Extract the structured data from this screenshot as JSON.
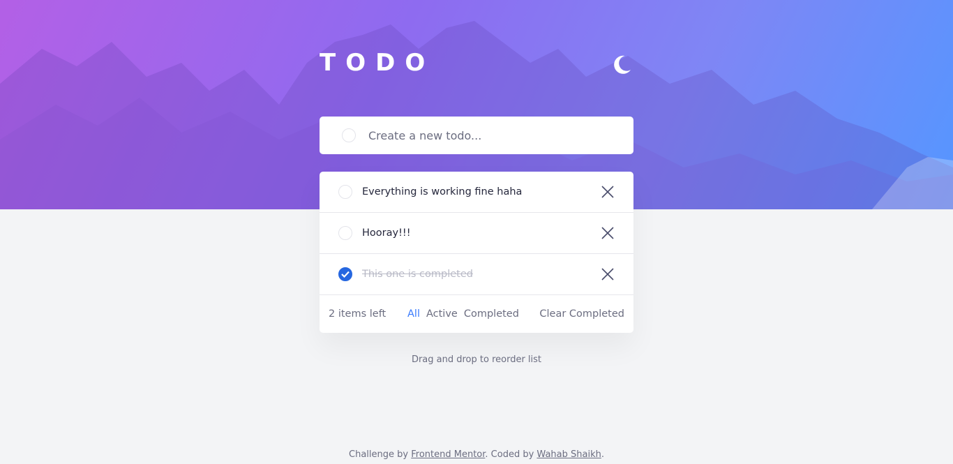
{
  "header": {
    "title": "TODO"
  },
  "icons": {
    "theme": "moon-icon",
    "check": "check-icon",
    "delete": "cross-icon"
  },
  "colors": {
    "accent": "#3a7bfd",
    "gradient_start": "#b360e6",
    "gradient_end": "#5596ff",
    "checked": "#2667e0"
  },
  "new_todo": {
    "placeholder": "Create a new todo..."
  },
  "todos": [
    {
      "text": "Everything is working fine haha",
      "completed": false
    },
    {
      "text": "Hooray!!!",
      "completed": false
    },
    {
      "text": "This one is completed",
      "completed": true
    }
  ],
  "footer": {
    "items_left": "2 items left",
    "filters": {
      "all": "All",
      "active": "Active",
      "completed": "Completed"
    },
    "selected_filter": "All",
    "clear_label": "Clear Completed"
  },
  "hint": "Drag and drop to reorder list",
  "credits": {
    "prefix": "Challenge by ",
    "link1": "Frontend Mentor",
    "middle": ". Coded by ",
    "link2": "Wahab Shaikh",
    "suffix": "."
  }
}
